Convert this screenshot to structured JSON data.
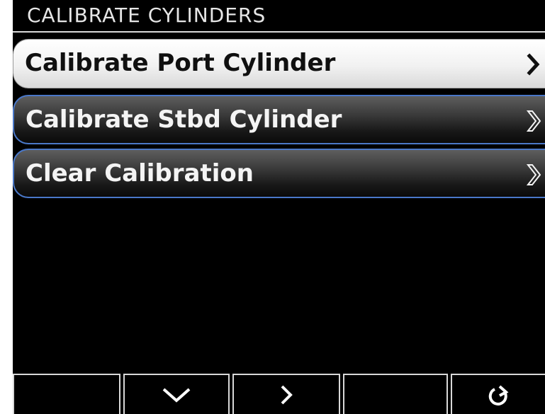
{
  "header": {
    "title": "CALIBRATE CYLINDERS"
  },
  "menu": {
    "items": [
      {
        "label": "Calibrate Port Cylinder",
        "selected": true,
        "icon": "chevron-right-icon"
      },
      {
        "label": "Calibrate Stbd Cylinder",
        "selected": false,
        "icon": "chevron-right-outline-icon"
      },
      {
        "label": "Clear Calibration",
        "selected": false,
        "icon": "chevron-right-outline-icon"
      }
    ]
  },
  "softkeys": [
    {
      "icon": ""
    },
    {
      "icon": "chevron-down-icon"
    },
    {
      "icon": "chevron-right-icon"
    },
    {
      "icon": ""
    },
    {
      "icon": "back-arrow-icon"
    }
  ],
  "colors": {
    "background": "#000000",
    "selected_item": "#f1f1f1",
    "item_border": "#4a78c9",
    "text_light": "#f4f4f4",
    "text_dark": "#101010"
  }
}
